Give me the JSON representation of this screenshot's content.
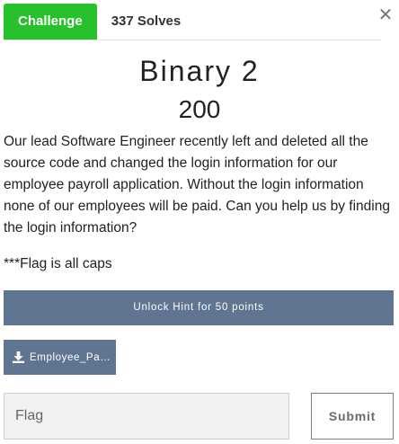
{
  "tabs": [
    {
      "label": "Challenge",
      "active": true
    },
    {
      "label": "337 Solves",
      "active": false
    }
  ],
  "close_icon": "close-icon",
  "challenge": {
    "title": "Binary 2",
    "points": "200",
    "description": "Our lead Software Engineer recently left and deleted all the source code and changed the login information for our employee payroll application. Without the login information none of our employees will be paid. Can you help us by finding the login information?",
    "note": "***Flag is all caps"
  },
  "hint_button": {
    "label": "Unlock Hint for 50 points"
  },
  "file_button": {
    "label": "Employee_Pa…",
    "icon": "download-icon"
  },
  "flag_input": {
    "placeholder": "Flag",
    "value": ""
  },
  "submit_button": {
    "label": "Submit"
  },
  "colors": {
    "accent": "#28c12b",
    "button": "#5f7592"
  }
}
